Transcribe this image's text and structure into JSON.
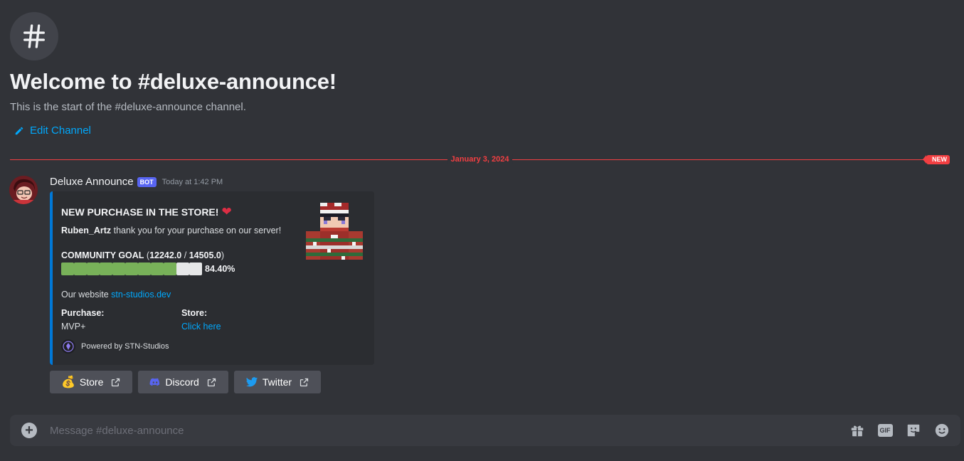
{
  "welcome": {
    "title": "Welcome to #deluxe-announce!",
    "subtitle": "This is the start of the #deluxe-announce channel.",
    "edit_label": "Edit Channel"
  },
  "divider": {
    "date": "January 3, 2024",
    "new_label": "NEW"
  },
  "message": {
    "author": "Deluxe Announce",
    "bot_tag": "BOT",
    "timestamp": "Today at 1:42 PM"
  },
  "embed": {
    "title": "NEW PURCHASE IN THE STORE!",
    "title_emoji": "❤",
    "buyer": "Ruben_Artz",
    "thanks": " thank you for your purchase on our server!",
    "goal_label": "COMMUNITY GOAL",
    "goal_open": " (",
    "goal_current": "12242.0",
    "goal_sep": " / ",
    "goal_target": "14505.0",
    "goal_close": ")",
    "progress_fraction": 0.844,
    "progress_percent": "84.40%",
    "website_label": "Our website ",
    "website_link": "stn-studios.dev",
    "fields": [
      {
        "name": "Purchase:",
        "value": "MVP+"
      },
      {
        "name": "Store:",
        "value": "Click here"
      }
    ],
    "footer": "Powered by STN-Studios",
    "accent_color": "#0078d7"
  },
  "buttons": [
    {
      "emoji": "💰",
      "label": "Store"
    },
    {
      "emoji": "discord-icon",
      "label": "Discord"
    },
    {
      "emoji": "twitter-icon",
      "label": "Twitter"
    }
  ],
  "composer": {
    "placeholder": "Message #deluxe-announce",
    "icons": [
      "gift-icon",
      "gif-icon",
      "sticker-icon",
      "emoji-icon"
    ],
    "gif_label": "GIF"
  }
}
